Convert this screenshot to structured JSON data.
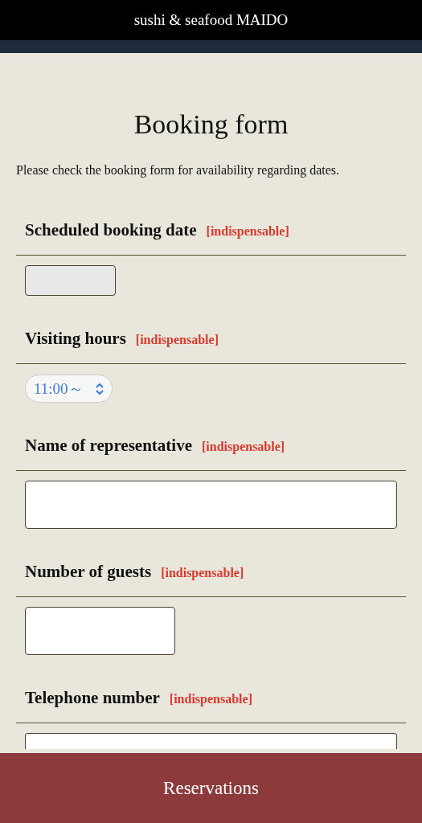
{
  "header": {
    "title": "sushi & seafood MAIDO"
  },
  "heading": "Booking form",
  "intro": "Please check the booking form for availability regarding dates.",
  "fields": [
    {
      "label": "Scheduled booking date",
      "badge": "[indispensable]",
      "kind": "date"
    },
    {
      "label": "Visiting hours",
      "badge": "[indispensable]",
      "kind": "select",
      "value": "11:00～"
    },
    {
      "label": "Name of representative",
      "badge": "[indispensable]",
      "kind": "text"
    },
    {
      "label": "Number of guests",
      "badge": "[indispensable]",
      "kind": "number"
    },
    {
      "label": "Telephone number",
      "badge": "[indispensable]",
      "kind": "tel"
    }
  ],
  "footer_button": "Reservations"
}
